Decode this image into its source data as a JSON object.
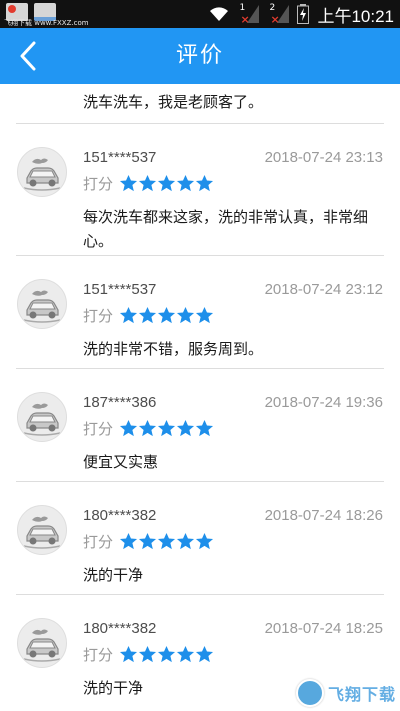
{
  "status_bar": {
    "watermark_text": "飞翔下载 www.FXXZ.com",
    "sim1_label": "1",
    "sim2_label": "2",
    "time": "上午10:21"
  },
  "header": {
    "title": "评价"
  },
  "reviews_partial": {
    "content": "洗车洗车，我是老顾客了。"
  },
  "reviews": [
    {
      "user": "151****537",
      "date": "2018-07-24 23:13",
      "score_label": "打分",
      "stars": 5,
      "content": "每次洗车都来这家，洗的非常认真，非常细心。"
    },
    {
      "user": "151****537",
      "date": "2018-07-24 23:12",
      "score_label": "打分",
      "stars": 5,
      "content": "洗的非常不错，服务周到。"
    },
    {
      "user": "187****386",
      "date": "2018-07-24 19:36",
      "score_label": "打分",
      "stars": 5,
      "content": "便宜又实惠"
    },
    {
      "user": "180****382",
      "date": "2018-07-24 18:26",
      "score_label": "打分",
      "stars": 5,
      "content": "洗的干净"
    },
    {
      "user": "180****382",
      "date": "2018-07-24 18:25",
      "score_label": "打分",
      "stars": 5,
      "content": "洗的干净"
    }
  ],
  "colors": {
    "header": "#2196f3",
    "star": "#1e8fea",
    "divider": "#dddddd"
  },
  "corner_logo": {
    "text": "飞翔下载"
  }
}
